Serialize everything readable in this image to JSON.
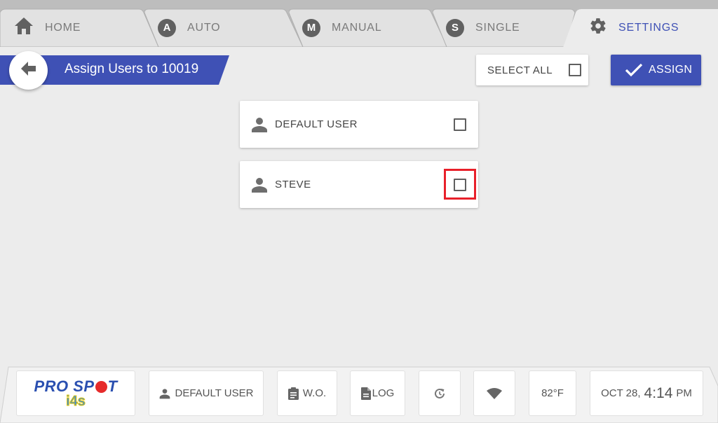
{
  "tabs": [
    {
      "label": "HOME",
      "icon": "home-icon",
      "active": false
    },
    {
      "label": "AUTO",
      "icon": "auto-icon",
      "icon_letter": "A",
      "active": false
    },
    {
      "label": "MANUAL",
      "icon": "manual-icon",
      "icon_letter": "M",
      "active": false
    },
    {
      "label": "SINGLE",
      "icon": "single-icon",
      "icon_letter": "S",
      "active": false
    },
    {
      "label": "SETTINGS",
      "icon": "gear-icon",
      "active": true
    }
  ],
  "header": {
    "title": "Assign Users to 10019",
    "back_icon": "arrow-left-icon",
    "select_all_label": "SELECT ALL",
    "select_all_checked": false,
    "assign_label": "ASSIGN",
    "assign_icon": "check-icon"
  },
  "users": [
    {
      "name": "DEFAULT USER",
      "checked": false
    },
    {
      "name": "STEVE",
      "checked": false,
      "highlighted": true
    }
  ],
  "footer": {
    "logo_top": "PRO SP",
    "logo_top_end": "T",
    "logo_bottom": "i4s",
    "current_user": "DEFAULT USER",
    "wo_label": "W.O.",
    "log_label": "LOG",
    "history_icon": "history-icon",
    "wifi_icon": "wifi-icon",
    "temperature": "82°F",
    "date": "OCT 28,",
    "time": "4:14",
    "ampm": "PM"
  },
  "colors": {
    "accent": "#3f51b5",
    "highlight": "#e8202a",
    "tabbar": "#bdbdbd",
    "background": "#ececec"
  }
}
